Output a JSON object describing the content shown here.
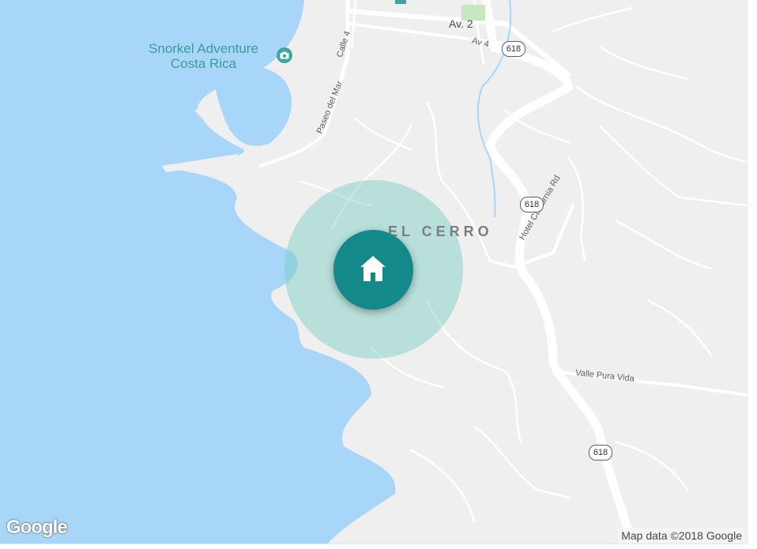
{
  "map": {
    "colors": {
      "water": "#a8d6f8",
      "land": "#efefef",
      "road": "#ffffff",
      "marker": "#13898a",
      "radius_fill": "#78cdc3",
      "poi": "#3da6a0"
    },
    "poi": {
      "name_line1": "Snorkel Adventure",
      "name_line2": "Costa Rica",
      "icon": "camera-icon"
    },
    "neighborhood": "EL CERRO",
    "streets": {
      "av2": "Av. 2",
      "av4": "Av 4",
      "calle4": "Calle 4",
      "paseo": "Paseo del Mar",
      "hotel_california": "Hotel California Rd",
      "valle_pura_vida": "Valle Pura Vida"
    },
    "route_shields": [
      "618",
      "618",
      "618"
    ],
    "marker": {
      "icon": "home-icon"
    },
    "branding": {
      "logo": "Google",
      "attribution": "Map data ©2018 Google"
    }
  }
}
